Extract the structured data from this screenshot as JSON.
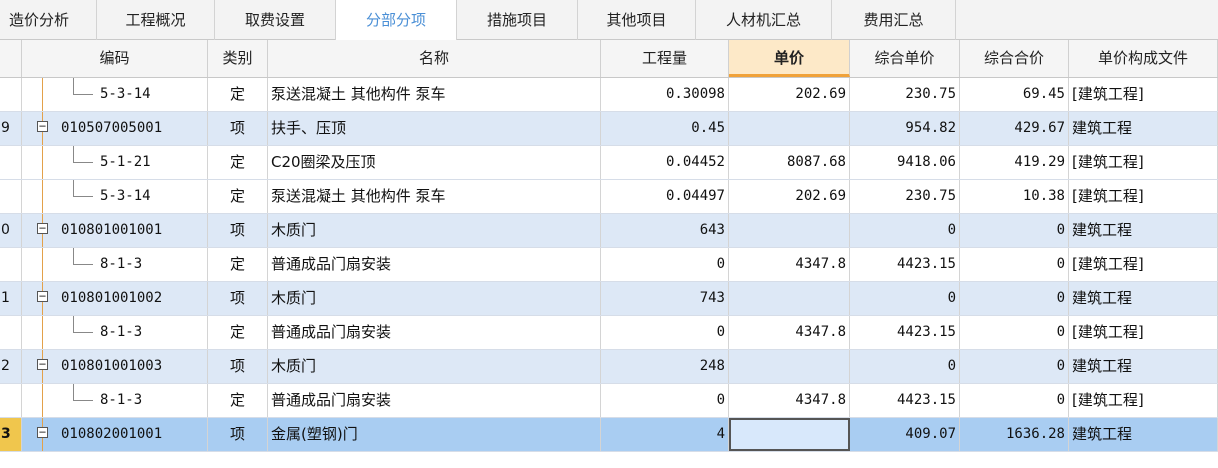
{
  "tabs": [
    {
      "label": "造价分析",
      "active": false
    },
    {
      "label": "工程概况",
      "active": false
    },
    {
      "label": "取费设置",
      "active": false
    },
    {
      "label": "分部分项",
      "active": true
    },
    {
      "label": "措施项目",
      "active": false
    },
    {
      "label": "其他项目",
      "active": false
    },
    {
      "label": "人材机汇总",
      "active": false
    },
    {
      "label": "费用汇总",
      "active": false
    }
  ],
  "columns": {
    "code": "编码",
    "type": "类别",
    "name": "名称",
    "qty": "工程量",
    "unit_price": "单价",
    "comp_unit": "综合单价",
    "comp_total": "综合合价",
    "file": "单价构成文件"
  },
  "rows": [
    {
      "num": "",
      "kind": "sub",
      "code": "5-3-14",
      "type": "定",
      "name": "泵送混凝土 其他构件 泵车",
      "qty": "0.30098",
      "unit_price": "202.69",
      "comp_unit": "230.75",
      "comp_total": "69.45",
      "file": "[建筑工程]"
    },
    {
      "num": "9",
      "kind": "item",
      "code": "010507005001",
      "type": "项",
      "name": "扶手、压顶",
      "qty": "0.45",
      "unit_price": "",
      "comp_unit": "954.82",
      "comp_total": "429.67",
      "file": "建筑工程"
    },
    {
      "num": "",
      "kind": "sub",
      "code": "5-1-21",
      "type": "定",
      "name": "C20圈梁及压顶",
      "qty": "0.04452",
      "unit_price": "8087.68",
      "comp_unit": "9418.06",
      "comp_total": "419.29",
      "file": "[建筑工程]"
    },
    {
      "num": "",
      "kind": "sub",
      "code": "5-3-14",
      "type": "定",
      "name": "泵送混凝土 其他构件 泵车",
      "qty": "0.04497",
      "unit_price": "202.69",
      "comp_unit": "230.75",
      "comp_total": "10.38",
      "file": "[建筑工程]"
    },
    {
      "num": "0",
      "kind": "item",
      "code": "010801001001",
      "type": "项",
      "name": "木质门",
      "qty": "643",
      "unit_price": "",
      "comp_unit": "0",
      "comp_total": "0",
      "file": "建筑工程"
    },
    {
      "num": "",
      "kind": "sub",
      "code": "8-1-3",
      "type": "定",
      "name": "普通成品门扇安装",
      "qty": "0",
      "unit_price": "4347.8",
      "comp_unit": "4423.15",
      "comp_total": "0",
      "file": "[建筑工程]"
    },
    {
      "num": "1",
      "kind": "item",
      "code": "010801001002",
      "type": "项",
      "name": "木质门",
      "qty": "743",
      "unit_price": "",
      "comp_unit": "0",
      "comp_total": "0",
      "file": "建筑工程"
    },
    {
      "num": "",
      "kind": "sub",
      "code": "8-1-3",
      "type": "定",
      "name": "普通成品门扇安装",
      "qty": "0",
      "unit_price": "4347.8",
      "comp_unit": "4423.15",
      "comp_total": "0",
      "file": "[建筑工程]"
    },
    {
      "num": "2",
      "kind": "item",
      "code": "010801001003",
      "type": "项",
      "name": "木质门",
      "qty": "248",
      "unit_price": "",
      "comp_unit": "0",
      "comp_total": "0",
      "file": "建筑工程"
    },
    {
      "num": "",
      "kind": "sub",
      "code": "8-1-3",
      "type": "定",
      "name": "普通成品门扇安装",
      "qty": "0",
      "unit_price": "4347.8",
      "comp_unit": "4423.15",
      "comp_total": "0",
      "file": "[建筑工程]"
    },
    {
      "num": "3",
      "kind": "current",
      "code": "010802001001",
      "type": "项",
      "name": "金属(塑钢)门",
      "qty": "4",
      "unit_price": "",
      "comp_unit": "409.07",
      "comp_total": "1636.28",
      "file": "建筑工程"
    }
  ],
  "colors": {
    "active_tab_text": "#4a8fd6",
    "item_row": "#dde8f6",
    "current_row": "#a9cdf2",
    "selected_header": "#fde9c8",
    "tree_line": "#e3a14a"
  },
  "icons": {
    "collapse": "minus-square-icon"
  }
}
